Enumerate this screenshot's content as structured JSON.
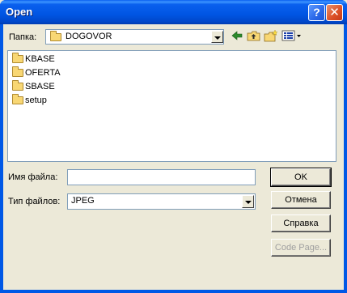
{
  "window": {
    "title": "Open",
    "help_symbol": "?",
    "close_symbol": "✕"
  },
  "lookin": {
    "label": "Папка:",
    "value": "DOGOVOR"
  },
  "files": [
    {
      "name": "KBASE",
      "icon": "folder-icon"
    },
    {
      "name": "OFERTA",
      "icon": "folder-icon"
    },
    {
      "name": "SBASE",
      "icon": "folder-icon"
    },
    {
      "name": "setup",
      "icon": "folder-icon"
    }
  ],
  "filename": {
    "label": "Имя файла:",
    "value": ""
  },
  "filetype": {
    "label": "Тип файлов:",
    "value": "JPEG"
  },
  "buttons": {
    "ok": "OK",
    "cancel": "Отмена",
    "help": "Справка",
    "codepage": "Code Page..."
  }
}
